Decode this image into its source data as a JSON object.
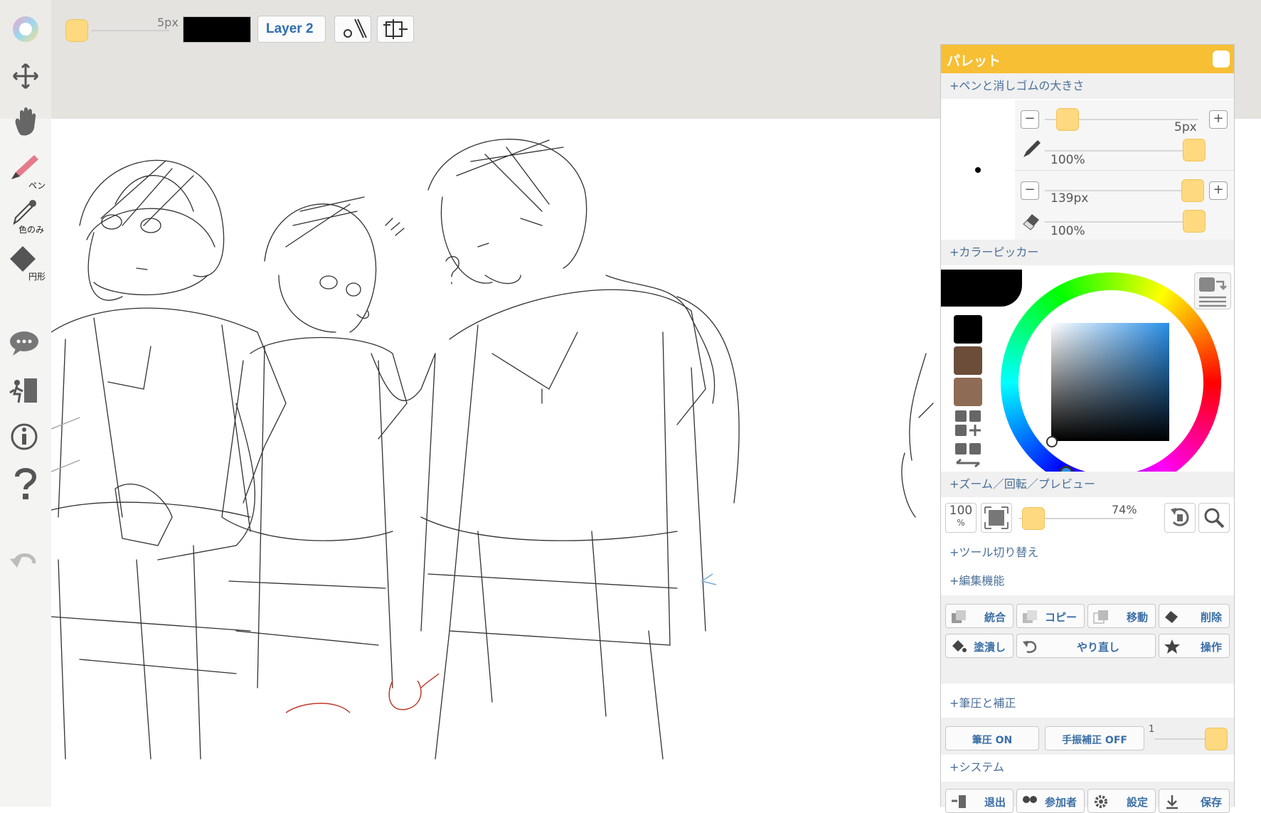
{
  "toolbar": {
    "brush_size": "5px",
    "layer_label": "Layer 2",
    "current_color": "#000000",
    "tools": [
      {
        "name": "color-wheel",
        "label": ""
      },
      {
        "name": "move",
        "label": ""
      },
      {
        "name": "hand",
        "label": ""
      },
      {
        "name": "pen",
        "label": "ペン"
      },
      {
        "name": "eyedropper",
        "label": "色のみ"
      },
      {
        "name": "shape",
        "label": "円形"
      },
      {
        "name": "chat",
        "label": ""
      },
      {
        "name": "exit",
        "label": ""
      },
      {
        "name": "info",
        "label": ""
      },
      {
        "name": "help",
        "label": ""
      }
    ]
  },
  "palette": {
    "title": "パレット",
    "sections": {
      "pen_eraser": "+ペンと消しゴムの大きさ",
      "color_picker": "+カラーピッカー",
      "zoom": "+ズーム／回転／プレビュー",
      "tool_switch": "+ツール切り替え",
      "edit": "+編集機能",
      "pressure": "+筆圧と補正",
      "system": "+システム"
    },
    "pen": {
      "size": "5px",
      "opacity": "100%"
    },
    "eraser": {
      "size": "139px",
      "opacity": "100%"
    },
    "swatches": [
      "#000000",
      "#6b4d3a",
      "#8e6b54"
    ],
    "zoom": {
      "hundred": "100",
      "percent_sign": "%",
      "level": "74%"
    },
    "edit_buttons": [
      {
        "label": "統合",
        "icon": "merge-icon"
      },
      {
        "label": "コピー",
        "icon": "copy-icon"
      },
      {
        "label": "移動",
        "icon": "move-layer-icon"
      },
      {
        "label": "削除",
        "icon": "delete-icon"
      },
      {
        "label": "塗潰し",
        "icon": "bucket-icon"
      },
      {
        "label": "やり直し",
        "icon": "undo-icon"
      },
      {
        "label": "操作",
        "icon": "star-icon"
      }
    ],
    "pressure": {
      "pressure_btn": "筆圧 ON",
      "stabilizer_btn": "手振補正 OFF",
      "stabilizer_value": "1"
    },
    "system_buttons": [
      {
        "label": "退出",
        "icon": "exit-icon"
      },
      {
        "label": "参加者",
        "icon": "users-icon"
      },
      {
        "label": "設定",
        "icon": "gear-icon"
      },
      {
        "label": "保存",
        "icon": "save-icon"
      }
    ]
  },
  "colors": {
    "accent": "#f7bf34",
    "knob": "#ffd980",
    "link": "#3a6ea5"
  }
}
